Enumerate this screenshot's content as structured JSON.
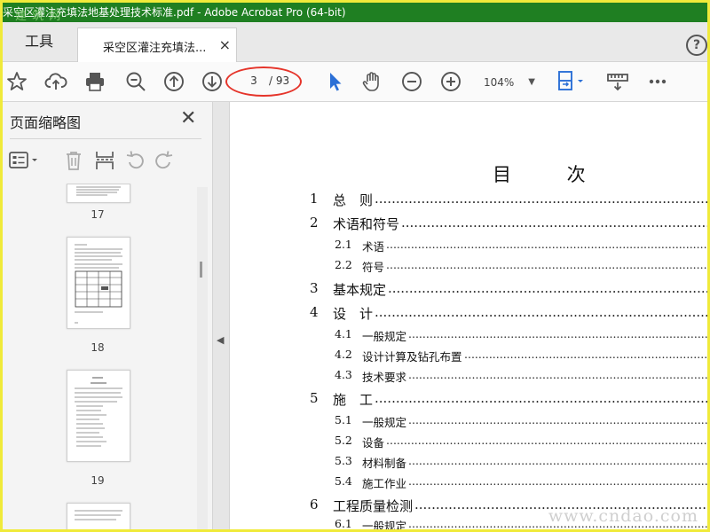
{
  "window": {
    "title": "采空区灌注充填法地基处理技术标准.pdf - Adobe Acrobat Pro (64-bit)"
  },
  "watermark_top": "建 筑 网",
  "watermark_bottom": "www.cndao.com",
  "tabs": {
    "tools": "工具",
    "document": "采空区灌注充填法...",
    "close": "×",
    "help": "?"
  },
  "toolbar": {
    "current_page": "3",
    "total_pages": "/ 93",
    "zoom": "104%",
    "icons": [
      "star-icon",
      "cloud-upload-icon",
      "print-icon",
      "zoom-out-search-icon",
      "page-up-icon",
      "page-down-icon",
      "select-cursor-icon",
      "hand-tool-icon",
      "zoom-minus-icon",
      "zoom-plus-icon",
      "fit-page-icon",
      "read-mode-icon",
      "more-icon"
    ]
  },
  "panel": {
    "title": "页面缩略图",
    "close": "✕",
    "thumbnails": [
      {
        "num": "17"
      },
      {
        "num": "18"
      },
      {
        "num": "19"
      }
    ]
  },
  "document": {
    "toc_title": "目 次",
    "entries": [
      {
        "num": "1",
        "text": "总　则",
        "level": 1
      },
      {
        "num": "2",
        "text": "术语和符号",
        "level": 1
      },
      {
        "num": "2.1",
        "text": "术语",
        "level": 2
      },
      {
        "num": "2.2",
        "text": "符号",
        "level": 2
      },
      {
        "num": "3",
        "text": "基本规定",
        "level": 1
      },
      {
        "num": "4",
        "text": "设　计",
        "level": 1
      },
      {
        "num": "4.1",
        "text": "一般规定",
        "level": 2
      },
      {
        "num": "4.2",
        "text": "设计计算及钻孔布置",
        "level": 2
      },
      {
        "num": "4.3",
        "text": "技术要求",
        "level": 2
      },
      {
        "num": "5",
        "text": "施　工",
        "level": 1
      },
      {
        "num": "5.1",
        "text": "一般规定",
        "level": 2
      },
      {
        "num": "5.2",
        "text": "设备",
        "level": 2
      },
      {
        "num": "5.3",
        "text": "材料制备",
        "level": 2
      },
      {
        "num": "5.4",
        "text": "施工作业",
        "level": 2
      },
      {
        "num": "6",
        "text": "工程质量检测",
        "level": 1
      },
      {
        "num": "6.1",
        "text": "一般规定",
        "level": 2
      }
    ]
  }
}
